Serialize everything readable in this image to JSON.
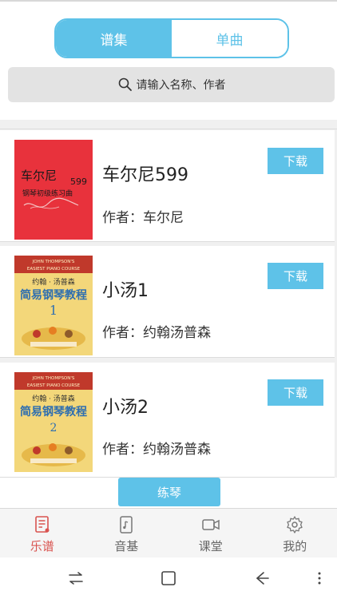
{
  "tabs_top": {
    "left_label": "谱集",
    "right_label": "单曲"
  },
  "search": {
    "placeholder": "请输入名称、作者"
  },
  "items": [
    {
      "title": "车尔尼599",
      "author": "作者：车尔尼",
      "download": "下载",
      "cover": {
        "line1": "车尔尼",
        "line2": "钢琴初级练习曲",
        "num": "599"
      }
    },
    {
      "title": "小汤1",
      "author": "作者：约翰汤普森",
      "download": "下载",
      "cover": {
        "banner": "JOHN THOMPSON'S EASIEST PIANO COURSE",
        "line1": "约翰 · 汤普森",
        "line2": "简易钢琴教程",
        "num": "1"
      }
    },
    {
      "title": "小汤2",
      "author": "作者：约翰汤普森",
      "download": "下载",
      "cover": {
        "banner": "JOHN THOMPSON'S EASIEST PIANO COURSE",
        "line1": "约翰 · 汤普森",
        "line2": "简易钢琴教程",
        "num": "2"
      }
    }
  ],
  "practice_button": "练琴",
  "bottom_tabs": [
    {
      "label": "乐谱",
      "icon": "score-icon",
      "active": true
    },
    {
      "label": "音基",
      "icon": "phone-music-icon",
      "active": false
    },
    {
      "label": "课堂",
      "icon": "video-camera-icon",
      "active": false
    },
    {
      "label": "我的",
      "icon": "gear-icon",
      "active": false
    }
  ],
  "colors": {
    "accent": "#5ec2e8",
    "active_tab": "#d9534f",
    "cover_red": "#e8323c",
    "cover_yellow": "#f3d77a"
  }
}
